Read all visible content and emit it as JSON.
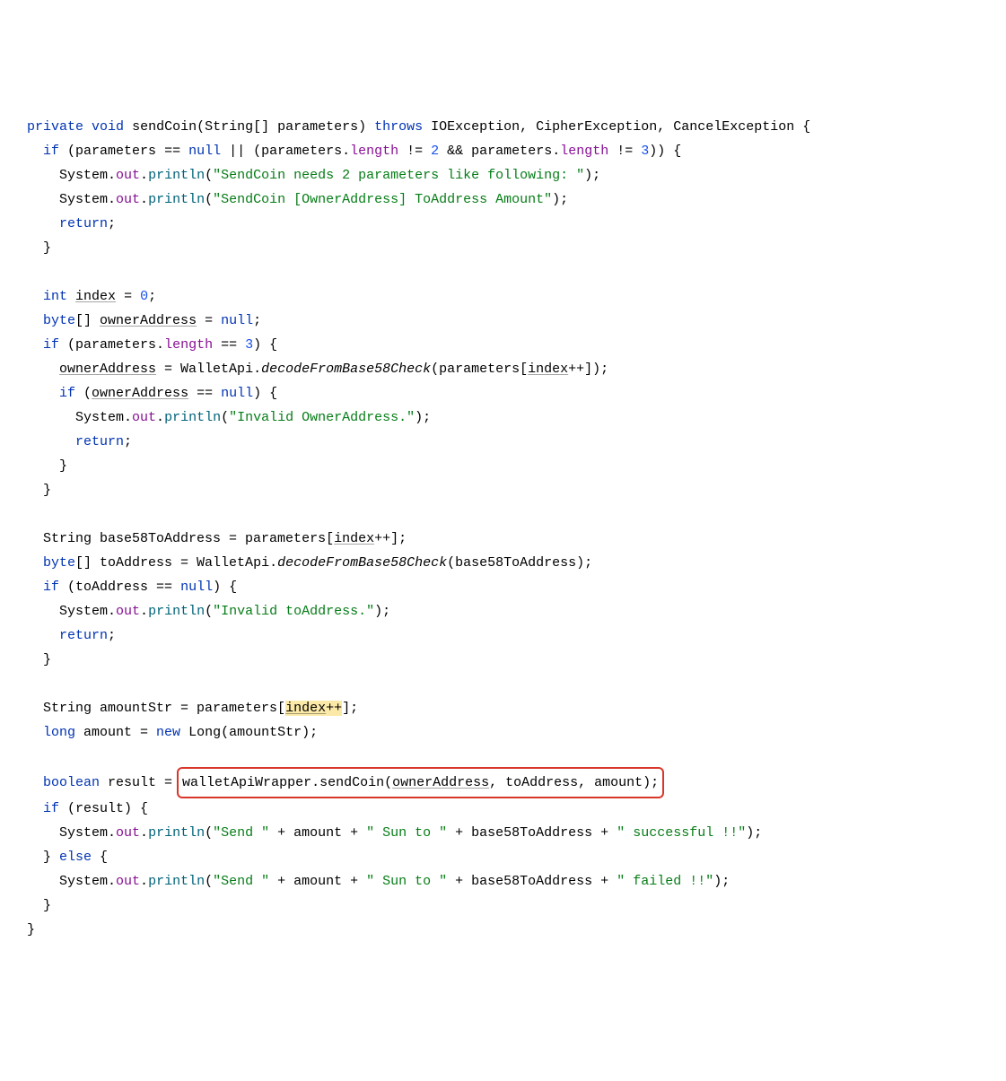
{
  "l1": {
    "kw1": "private",
    "kw2": "void",
    "name": "sendCoin",
    "p": "(String[] parameters)",
    "kw3": "throws",
    "ex": "IOException, CipherException, CancelException {"
  },
  "l2": {
    "kw1": "if",
    "a": "(parameters == ",
    "kw2": "null",
    "b": " || (parameters.",
    "len1": "length",
    "c": " != ",
    "n1": "2",
    "d": " && parameters.",
    "len2": "length",
    "e": " != ",
    "n2": "3",
    "f": ")) {"
  },
  "l3": {
    "a": "System.",
    "out": "out",
    "b": ".",
    "m": "println",
    "c": "(",
    "s": "\"SendCoin needs 2 parameters like following: \"",
    "d": ");"
  },
  "l4": {
    "a": "System.",
    "out": "out",
    "b": ".",
    "m": "println",
    "c": "(",
    "s": "\"SendCoin [OwnerAddress] ToAddress Amount\"",
    "d": ");"
  },
  "l5": {
    "kw": "return",
    "a": ";"
  },
  "l6": {
    "a": "}"
  },
  "l8": {
    "kw": "int",
    "a": " ",
    "u": "index",
    "b": " = ",
    "n": "0",
    "c": ";"
  },
  "l9": {
    "kw": "byte",
    "a": "[] ",
    "u": "ownerAddress",
    "b": " = ",
    "kw2": "null",
    "c": ";"
  },
  "l10": {
    "kw": "if",
    "a": " (parameters.",
    "len": "length",
    "b": " == ",
    "n": "3",
    "c": ") {"
  },
  "l11": {
    "u1": "ownerAddress",
    "a": " = WalletApi.",
    "sm": "decodeFromBase58Check",
    "b": "(parameters[",
    "u2": "index",
    "c": "++]);"
  },
  "l12": {
    "kw": "if",
    "a": " (",
    "u": "ownerAddress",
    "b": " == ",
    "kw2": "null",
    "c": ") {"
  },
  "l13": {
    "a": "System.",
    "out": "out",
    "b": ".",
    "m": "println",
    "c": "(",
    "s": "\"Invalid OwnerAddress.\"",
    "d": ");"
  },
  "l14": {
    "kw": "return",
    "a": ";"
  },
  "l15": {
    "a": "}"
  },
  "l16": {
    "a": "}"
  },
  "l18": {
    "a": "String base58ToAddress = parameters[",
    "u": "index",
    "b": "++];"
  },
  "l19": {
    "kw": "byte",
    "a": "[] toAddress = WalletApi.",
    "sm": "decodeFromBase58Check",
    "b": "(base58ToAddress);"
  },
  "l20": {
    "kw": "if",
    "a": " (toAddress == ",
    "kw2": "null",
    "b": ") {"
  },
  "l21": {
    "a": "System.",
    "out": "out",
    "b": ".",
    "m": "println",
    "c": "(",
    "s": "\"Invalid toAddress.\"",
    "d": ");"
  },
  "l22": {
    "kw": "return",
    "a": ";"
  },
  "l23": {
    "a": "}"
  },
  "l25": {
    "a": "String amountStr = parameters[",
    "u": "index",
    "b": "++",
    "c": "];"
  },
  "l26": {
    "kw": "long",
    "a": " amount = ",
    "kw2": "new",
    "b": " Long(amountStr);"
  },
  "l28": {
    "kw": "boolean",
    "a": " result = ",
    "box": {
      "a": "walletApiWrapper.sendCoin(",
      "u": "ownerAddress",
      "b": ", toAddress, amount);"
    }
  },
  "l29": {
    "kw": "if",
    "a": " (result) {"
  },
  "l30": {
    "a": "System.",
    "out": "out",
    "b": ".",
    "m": "println",
    "c": "(",
    "s1": "\"Send \"",
    "d": " + amount + ",
    "s2": "\" Sun to \"",
    "e": " + base58ToAddress + ",
    "s3": "\" successful !!\"",
    "f": ");"
  },
  "l31": {
    "a": "} ",
    "kw": "else",
    "b": " {"
  },
  "l32": {
    "a": "System.",
    "out": "out",
    "b": ".",
    "m": "println",
    "c": "(",
    "s1": "\"Send \"",
    "d": " + amount + ",
    "s2": "\" Sun to \"",
    "e": " + base58ToAddress + ",
    "s3": "\" failed !!\"",
    "f": ");"
  },
  "l33": {
    "a": "}"
  },
  "l34": {
    "a": "}"
  }
}
